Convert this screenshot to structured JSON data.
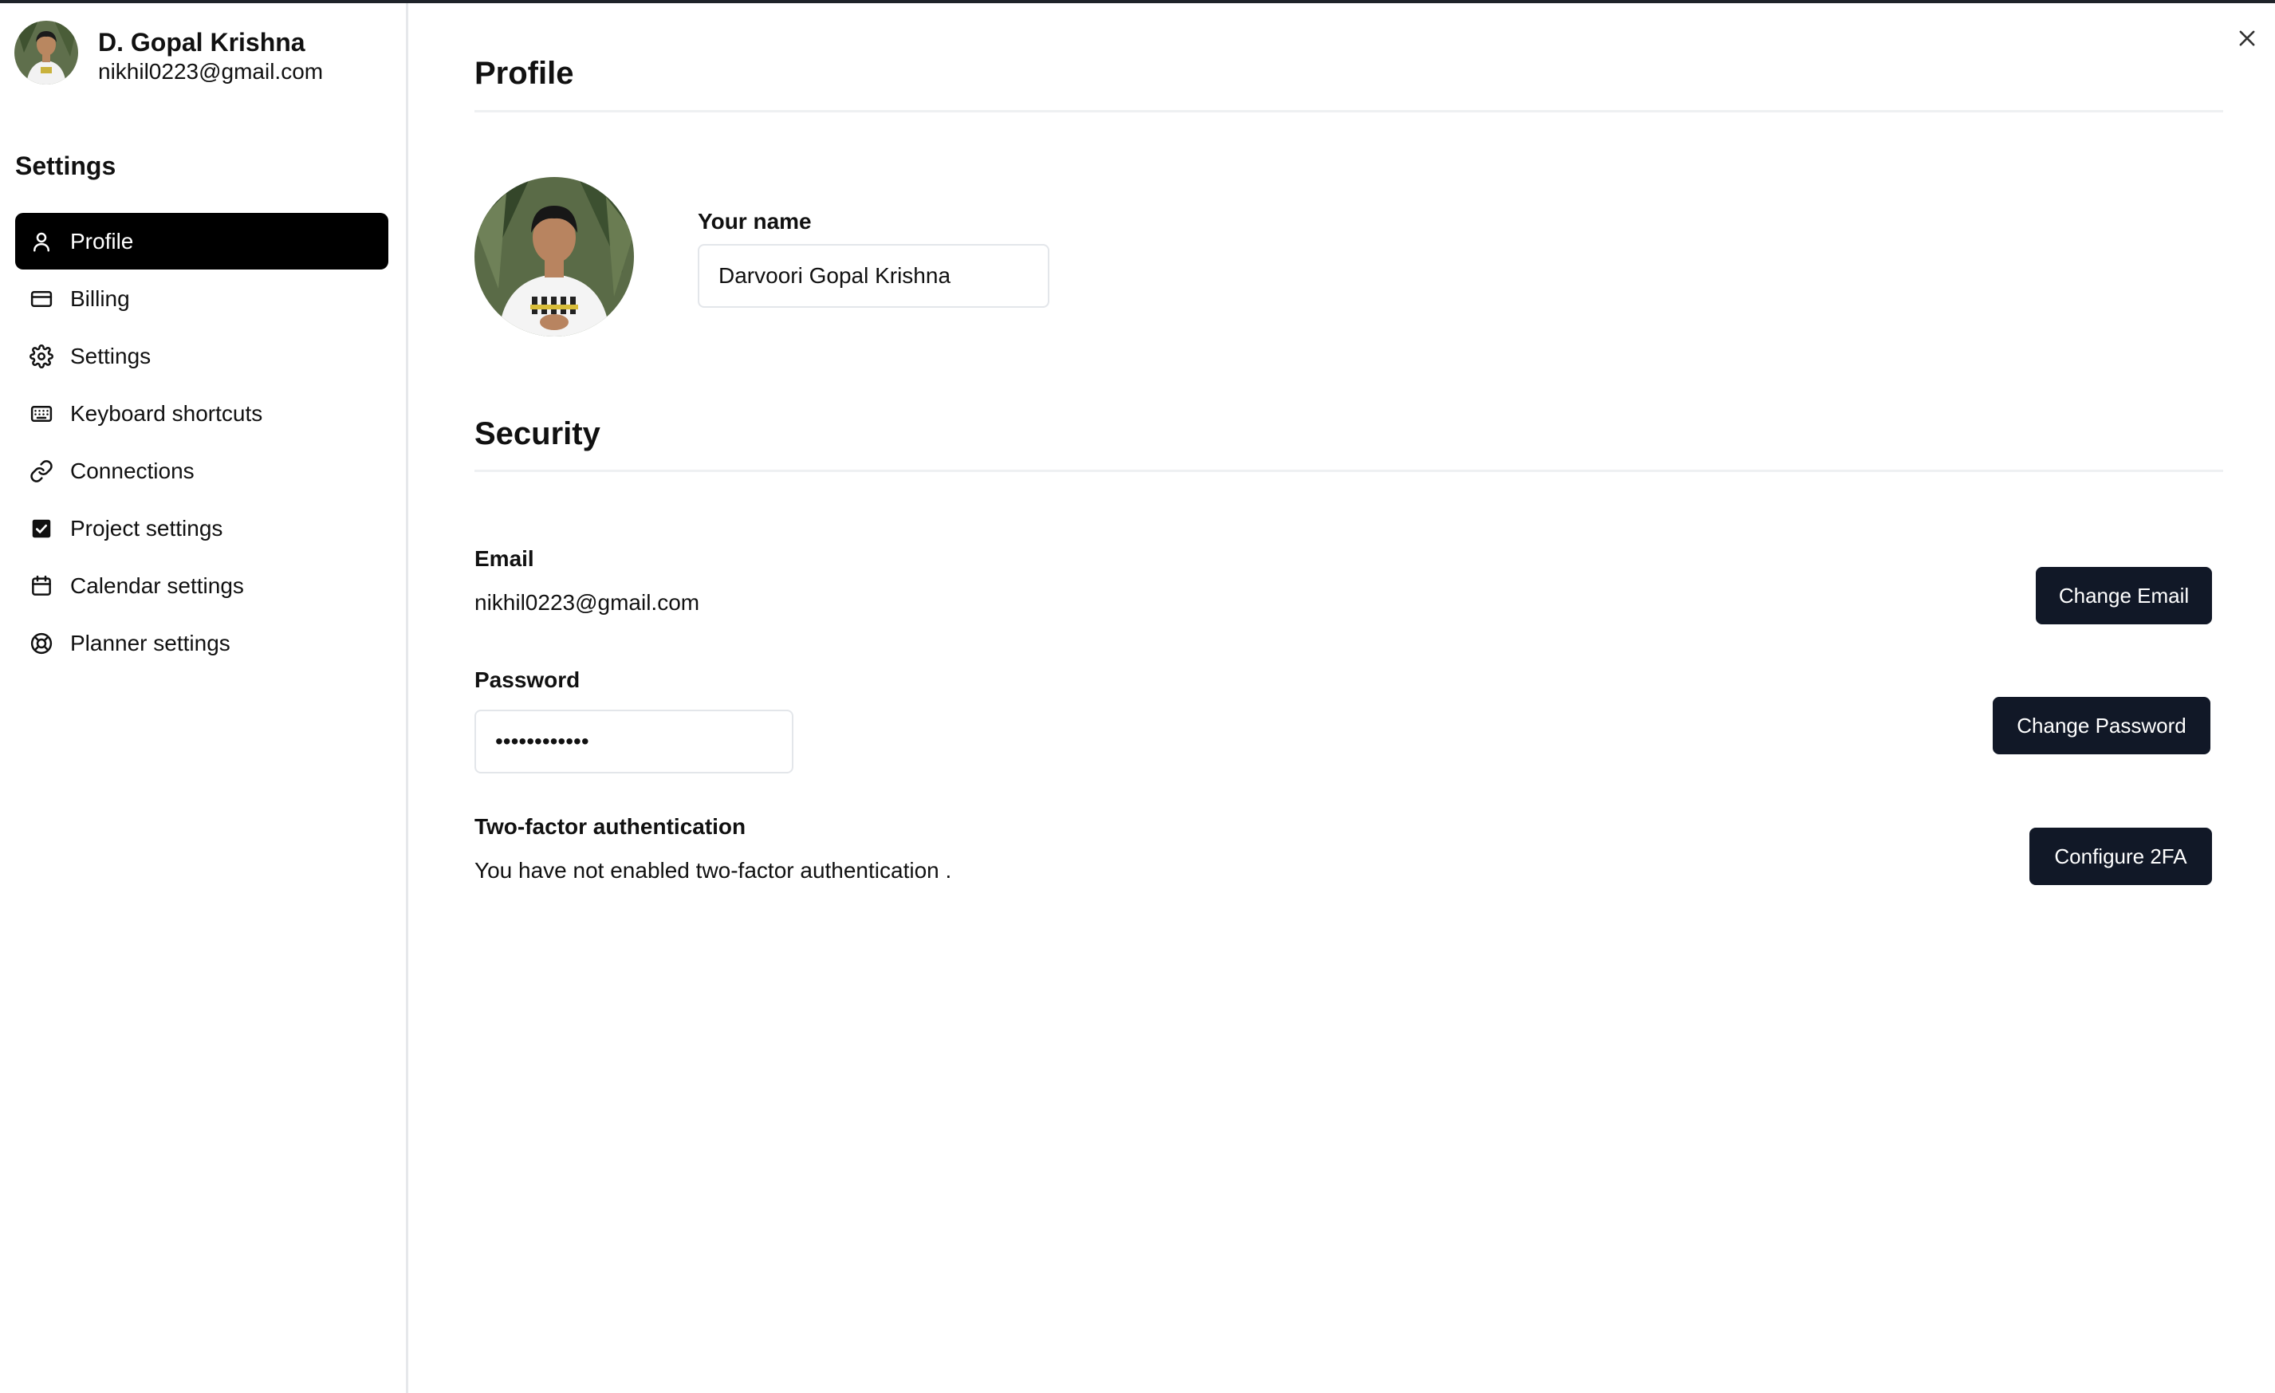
{
  "user": {
    "name": "D. Gopal Krishna",
    "email": "nikhil0223@gmail.com"
  },
  "sidebar": {
    "heading": "Settings",
    "items": [
      {
        "label": "Profile",
        "icon": "user-icon",
        "active": true
      },
      {
        "label": "Billing",
        "icon": "credit-card-icon",
        "active": false
      },
      {
        "label": "Settings",
        "icon": "gear-icon",
        "active": false
      },
      {
        "label": "Keyboard shortcuts",
        "icon": "keyboard-icon",
        "active": false
      },
      {
        "label": "Connections",
        "icon": "link-icon",
        "active": false
      },
      {
        "label": "Project settings",
        "icon": "checkbox-icon",
        "active": false
      },
      {
        "label": "Calendar settings",
        "icon": "calendar-icon",
        "active": false
      },
      {
        "label": "Planner settings",
        "icon": "lifebuoy-icon",
        "active": false
      }
    ]
  },
  "profile": {
    "title": "Profile",
    "name_label": "Your name",
    "name_value": "Darvoori Gopal Krishna"
  },
  "security": {
    "title": "Security",
    "email_label": "Email",
    "email_value": "nikhil0223@gmail.com",
    "change_email_label": "Change Email",
    "password_label": "Password",
    "password_value": "••••••••••••",
    "change_password_label": "Change Password",
    "twofa_label": "Two-factor authentication",
    "twofa_status": "You have not enabled two-factor authentication .",
    "configure_2fa_label": "Configure 2FA"
  },
  "colors": {
    "active_nav_bg": "#000000",
    "button_bg": "#111827",
    "divider": "#eef0f2"
  }
}
